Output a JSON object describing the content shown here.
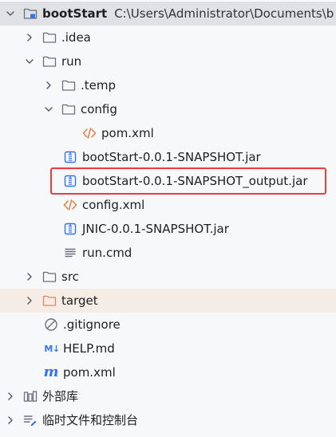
{
  "project": {
    "name": "bootStart",
    "path": "C:\\Users\\Administrator\\Documents\\b"
  },
  "items": [
    {
      "label": ".idea"
    },
    {
      "label": "run"
    },
    {
      "label": ".temp"
    },
    {
      "label": "config"
    },
    {
      "label": "pom.xml"
    },
    {
      "label": "bootStart-0.0.1-SNAPSHOT.jar"
    },
    {
      "label": "bootStart-0.0.1-SNAPSHOT_output.jar"
    },
    {
      "label": "config.xml"
    },
    {
      "label": "JNIC-0.0.1-SNAPSHOT.jar"
    },
    {
      "label": "run.cmd"
    },
    {
      "label": "src"
    },
    {
      "label": "target"
    },
    {
      "label": ".gitignore"
    },
    {
      "label": "HELP.md"
    },
    {
      "label": "pom.xml"
    }
  ],
  "external_libraries": {
    "label": "外部库"
  },
  "scratches": {
    "label": "临时文件和控制台"
  },
  "icons": {
    "md_icon_text": "M↓",
    "maven_icon_text": "m"
  },
  "colors": {
    "folder": "#6c707e",
    "excluded_folder": "#e08855",
    "xml": "#e27e4b",
    "jar": "#3574f0",
    "highlight": "#ef3b3b",
    "selected_row": "#dfe1e5"
  }
}
